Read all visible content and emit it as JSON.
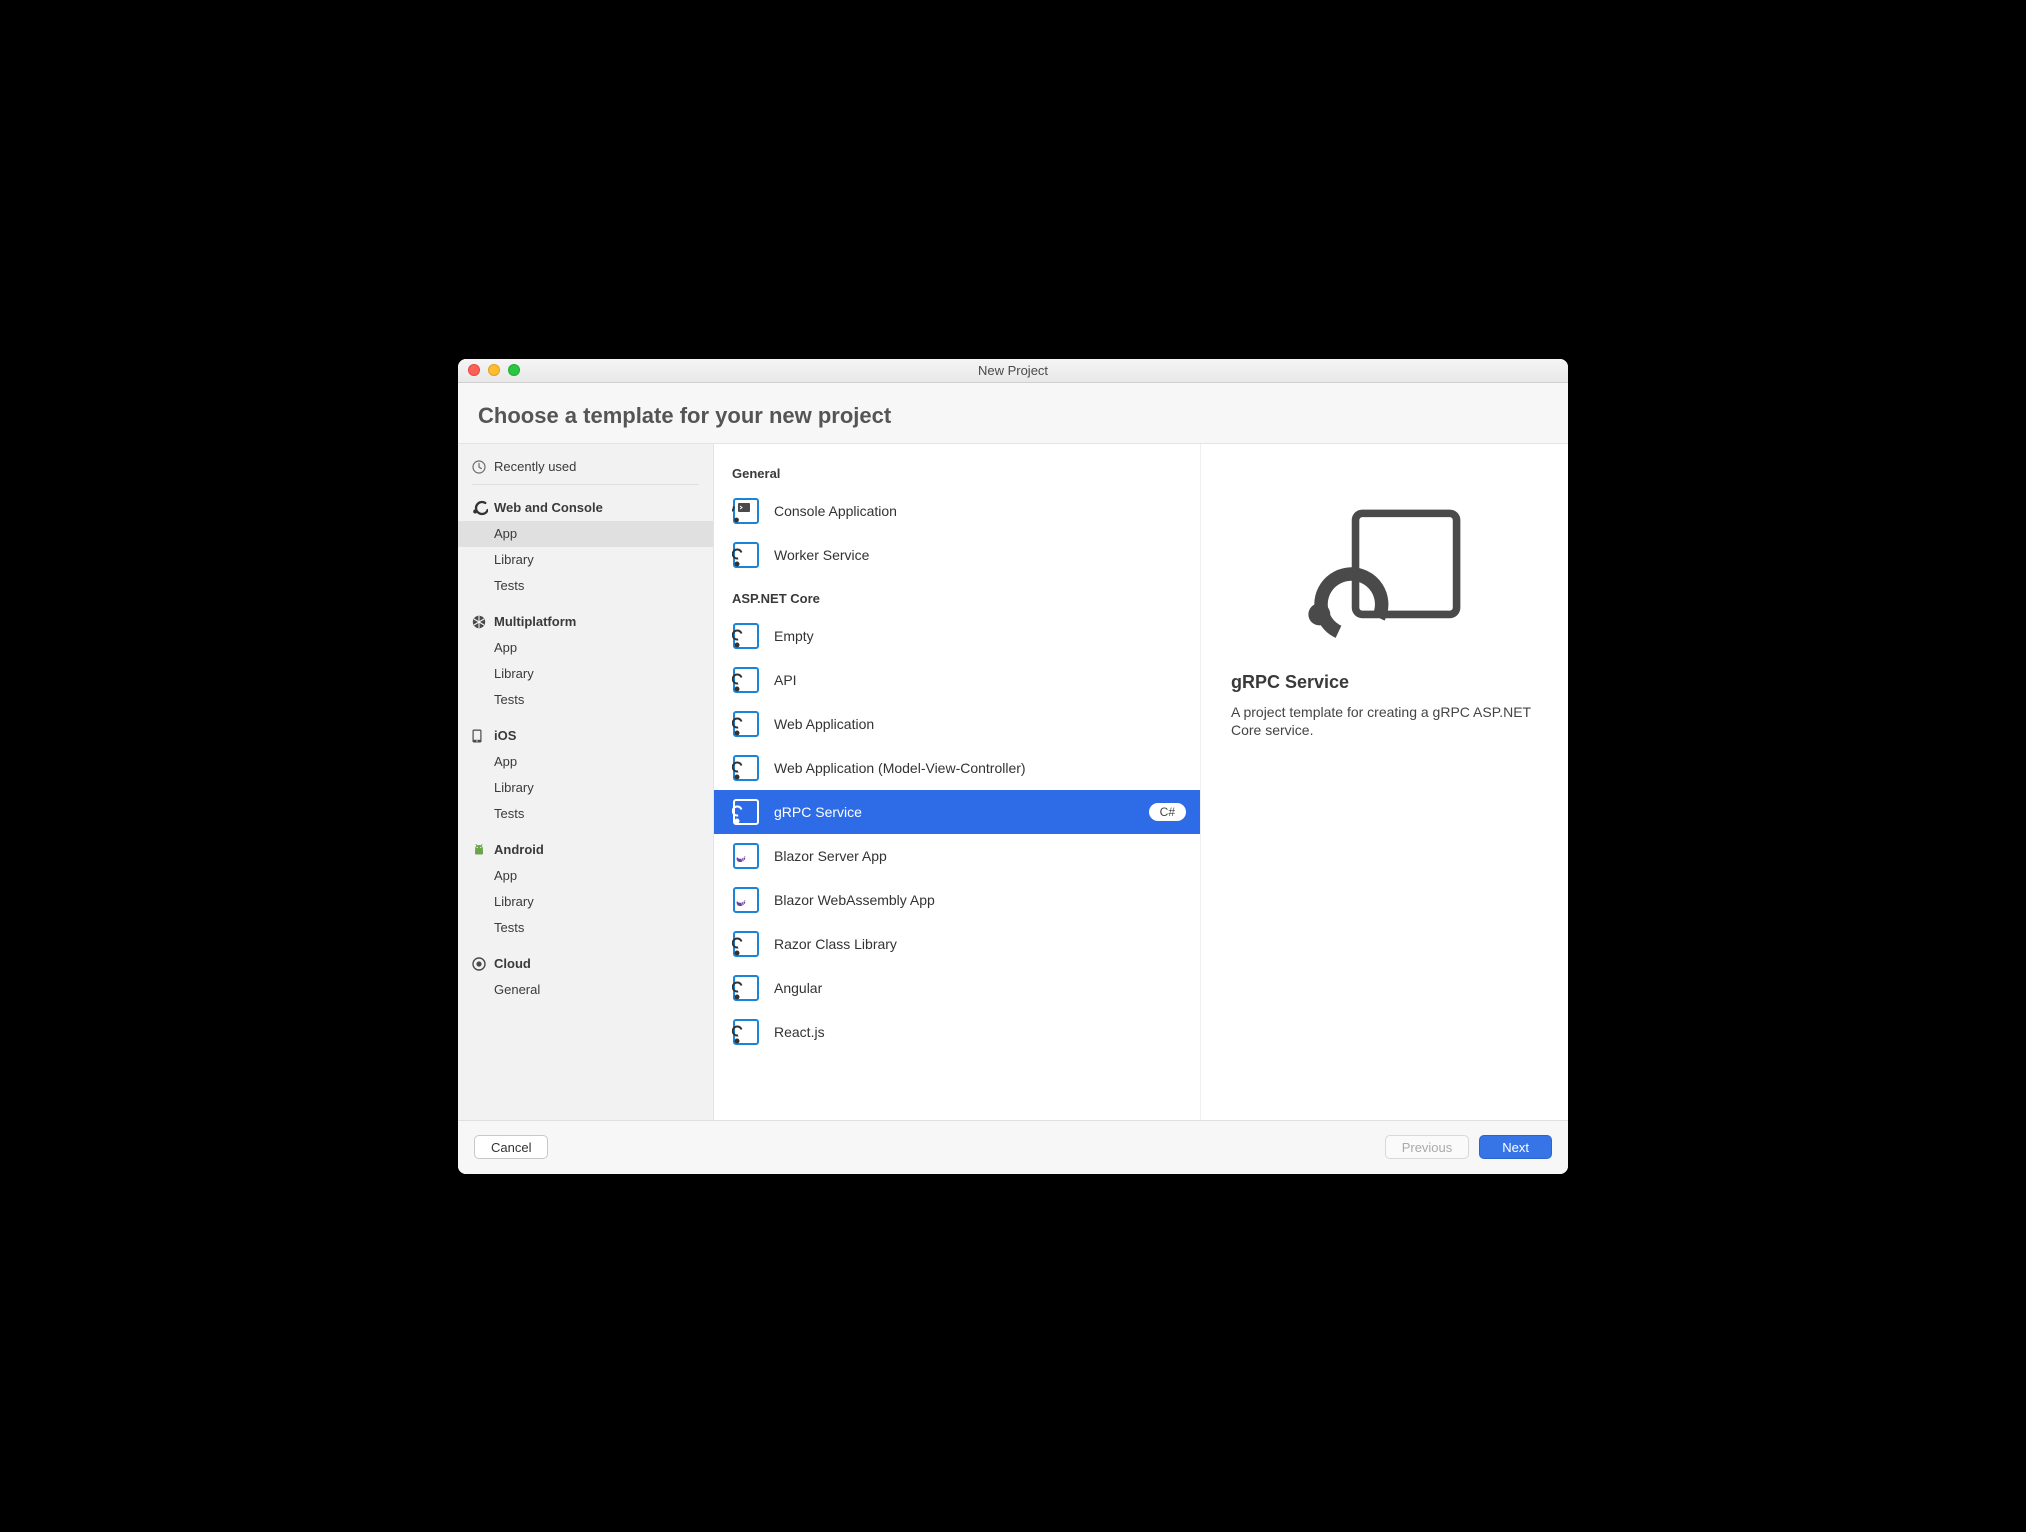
{
  "window": {
    "title": "New Project"
  },
  "header": {
    "title": "Choose a template for your new project"
  },
  "sidebar": {
    "recently_used": {
      "label": "Recently used"
    },
    "groups": [
      {
        "id": "web-console",
        "label": "Web and Console",
        "icon": "dotnet-icon",
        "items": [
          {
            "id": "app",
            "label": "App",
            "selected": true
          },
          {
            "id": "library",
            "label": "Library"
          },
          {
            "id": "tests",
            "label": "Tests"
          }
        ]
      },
      {
        "id": "multiplatform",
        "label": "Multiplatform",
        "icon": "multiplatform-icon",
        "items": [
          {
            "id": "app",
            "label": "App"
          },
          {
            "id": "library",
            "label": "Library"
          },
          {
            "id": "tests",
            "label": "Tests"
          }
        ]
      },
      {
        "id": "ios",
        "label": "iOS",
        "icon": "phone-icon",
        "items": [
          {
            "id": "app",
            "label": "App"
          },
          {
            "id": "library",
            "label": "Library"
          },
          {
            "id": "tests",
            "label": "Tests"
          }
        ]
      },
      {
        "id": "android",
        "label": "Android",
        "icon": "android-icon",
        "items": [
          {
            "id": "app",
            "label": "App"
          },
          {
            "id": "library",
            "label": "Library"
          },
          {
            "id": "tests",
            "label": "Tests"
          }
        ]
      },
      {
        "id": "cloud",
        "label": "Cloud",
        "icon": "target-icon",
        "items": [
          {
            "id": "general",
            "label": "General"
          }
        ]
      }
    ]
  },
  "templates": {
    "sections": [
      {
        "id": "general",
        "title": "General",
        "items": [
          {
            "id": "console-app",
            "label": "Console Application"
          },
          {
            "id": "worker-service",
            "label": "Worker Service"
          }
        ]
      },
      {
        "id": "aspnet",
        "title": "ASP.NET Core",
        "items": [
          {
            "id": "empty",
            "label": "Empty"
          },
          {
            "id": "api",
            "label": "API"
          },
          {
            "id": "webapp",
            "label": "Web Application"
          },
          {
            "id": "mvc",
            "label": "Web Application (Model-View-Controller)"
          },
          {
            "id": "grpc",
            "label": "gRPC Service",
            "selected": true,
            "language": "C#"
          },
          {
            "id": "blazor-server",
            "label": "Blazor Server App",
            "icon": "blazor"
          },
          {
            "id": "blazor-wasm",
            "label": "Blazor WebAssembly App",
            "icon": "blazor"
          },
          {
            "id": "razor-lib",
            "label": "Razor Class Library"
          },
          {
            "id": "angular",
            "label": "Angular"
          },
          {
            "id": "react",
            "label": "React.js"
          }
        ]
      }
    ]
  },
  "detail": {
    "title": "gRPC Service",
    "description": "A project template for creating a gRPC ASP.NET Core service."
  },
  "footer": {
    "cancel": "Cancel",
    "previous": "Previous",
    "next": "Next"
  }
}
